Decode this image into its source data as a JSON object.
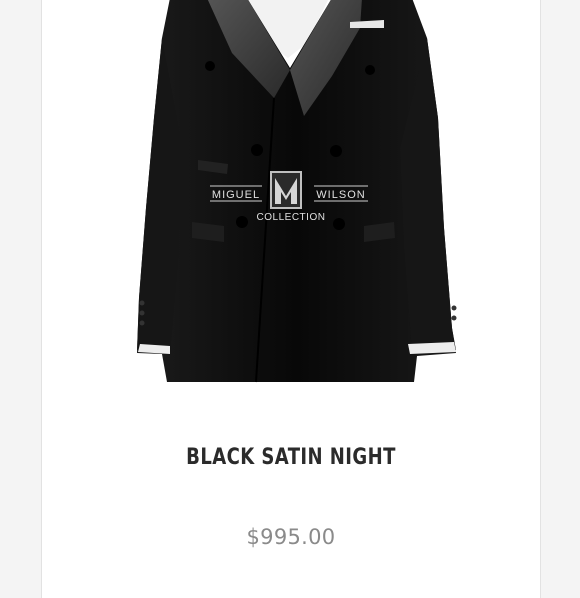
{
  "product": {
    "title": "BLACK SATIN NIGHT",
    "price": "$995.00",
    "image": {
      "subject": "black satin double-breasted tuxedo jacket",
      "watermark_lines": [
        "MIGUEL",
        "WILSON",
        "COLLECTION"
      ]
    }
  },
  "colors": {
    "card_bg": "#ffffff",
    "page_bg": "#f4f4f4",
    "title": "#2b2b2b",
    "price": "#8a8a8a",
    "jacket": "#0d0d0d",
    "lapel": "#3e3e3e"
  }
}
